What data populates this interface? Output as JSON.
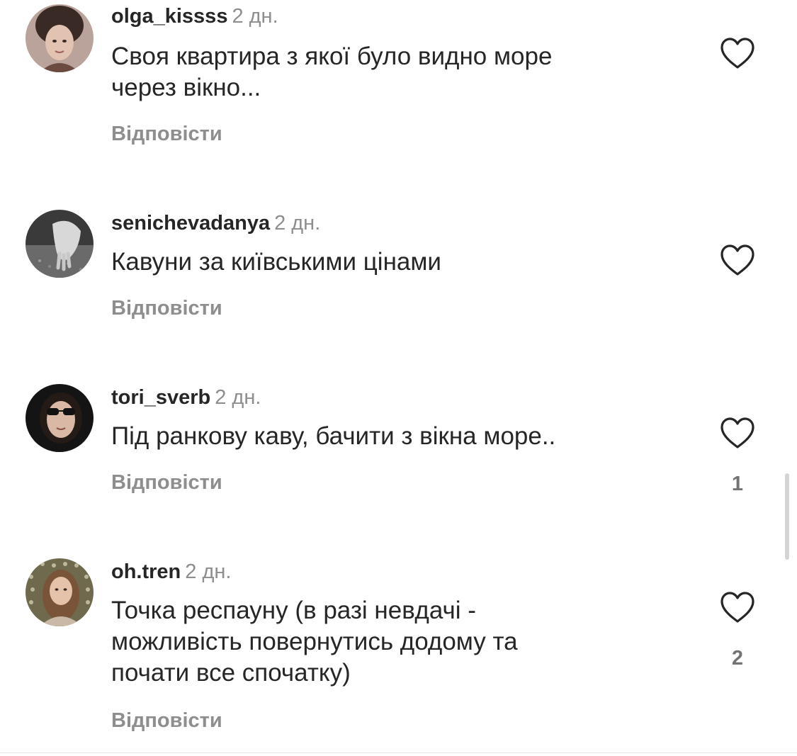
{
  "comments": [
    {
      "username": "olga_kissss",
      "time": "2 дн.",
      "lines": [
        "Своя квартира з якої було видно море",
        "через вікно..."
      ],
      "reply_label": "Відповісти",
      "like_count": ""
    },
    {
      "username": "senichevadanya",
      "time": "2 дн.",
      "lines": [
        "Кавуни за київськими цінами"
      ],
      "reply_label": "Відповісти",
      "like_count": ""
    },
    {
      "username": "tori_sverb",
      "time": "2 дн.",
      "lines": [
        "Під ранкову каву, бачити з вікна море.."
      ],
      "reply_label": "Відповісти",
      "like_count": "1"
    },
    {
      "username": "oh.tren",
      "time": "2 дн.",
      "lines": [
        "Точка респауну (в разі невдачі -",
        "можливість повернутись додому та",
        "почати все спочатку)"
      ],
      "reply_label": "Відповісти",
      "like_count": "2"
    }
  ],
  "icons": {
    "like": "heart-outline-icon"
  },
  "colors": {
    "text": "#262626",
    "secondary": "#8e8e8e"
  }
}
